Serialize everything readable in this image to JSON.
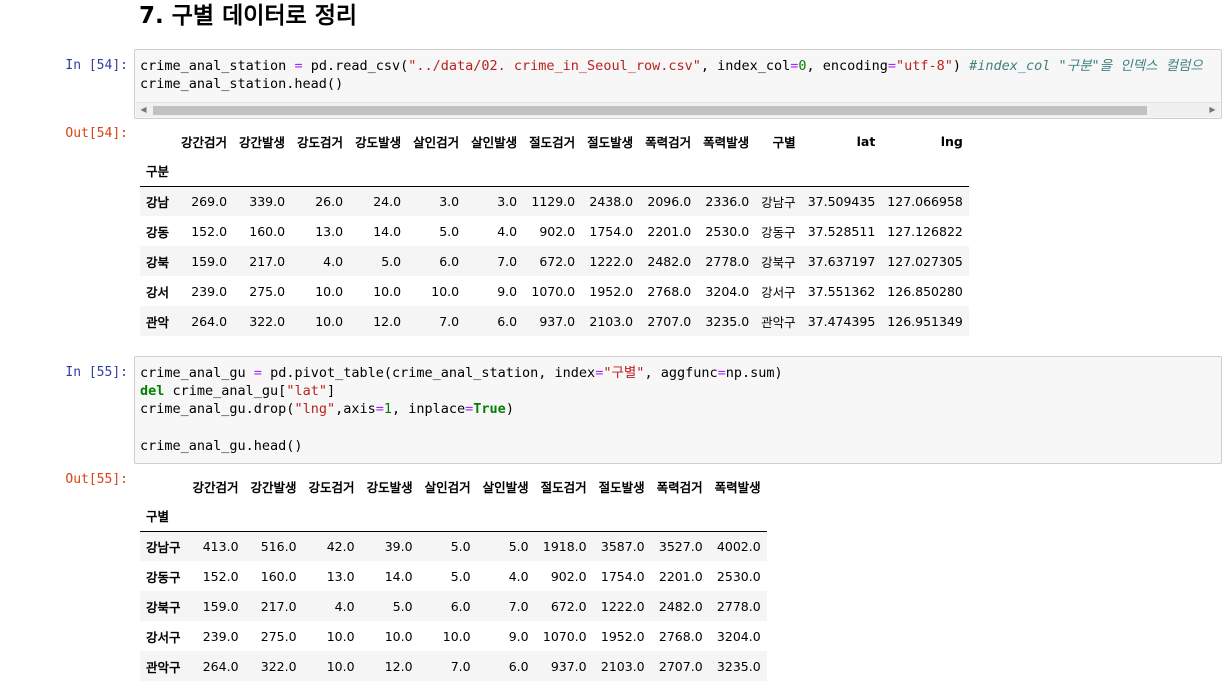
{
  "heading": "7. 구별 데이터로 정리",
  "cell54": {
    "in_prompt": "In [54]:",
    "out_prompt": "Out[54]:",
    "code": [
      [
        [
          "crime_anal_station ",
          ""
        ],
        [
          "=",
          "op"
        ],
        [
          " pd.read_csv(",
          ""
        ],
        [
          "\"../data/02. crime_in_Seoul_row.csv\"",
          "str"
        ],
        [
          ", index_col",
          ""
        ],
        [
          "=",
          "op"
        ],
        [
          "0",
          "num"
        ],
        [
          ", encoding",
          ""
        ],
        [
          "=",
          "op"
        ],
        [
          "\"utf-8\"",
          "str"
        ],
        [
          ") ",
          ""
        ],
        [
          "#index_col \"구분\"을 인덱스 컬럼으",
          "cm"
        ]
      ],
      [
        [
          "crime_anal_station.head()",
          ""
        ]
      ]
    ],
    "table": {
      "columns": [
        "강간검거",
        "강간발생",
        "강도검거",
        "강도발생",
        "살인검거",
        "살인발생",
        "절도검거",
        "절도발생",
        "폭력검거",
        "폭력발생",
        "구별",
        "lat",
        "lng"
      ],
      "index_name": "구분",
      "rows": [
        {
          "index": "강남",
          "values": [
            "269.0",
            "339.0",
            "26.0",
            "24.0",
            "3.0",
            "3.0",
            "1129.0",
            "2438.0",
            "2096.0",
            "2336.0",
            "강남구",
            "37.509435",
            "127.066958"
          ]
        },
        {
          "index": "강동",
          "values": [
            "152.0",
            "160.0",
            "13.0",
            "14.0",
            "5.0",
            "4.0",
            "902.0",
            "1754.0",
            "2201.0",
            "2530.0",
            "강동구",
            "37.528511",
            "127.126822"
          ]
        },
        {
          "index": "강북",
          "values": [
            "159.0",
            "217.0",
            "4.0",
            "5.0",
            "6.0",
            "7.0",
            "672.0",
            "1222.0",
            "2482.0",
            "2778.0",
            "강북구",
            "37.637197",
            "127.027305"
          ]
        },
        {
          "index": "강서",
          "values": [
            "239.0",
            "275.0",
            "10.0",
            "10.0",
            "10.0",
            "9.0",
            "1070.0",
            "1952.0",
            "2768.0",
            "3204.0",
            "강서구",
            "37.551362",
            "126.850280"
          ]
        },
        {
          "index": "관악",
          "values": [
            "264.0",
            "322.0",
            "10.0",
            "12.0",
            "7.0",
            "6.0",
            "937.0",
            "2103.0",
            "2707.0",
            "3235.0",
            "관악구",
            "37.474395",
            "126.951349"
          ]
        }
      ]
    }
  },
  "cell55": {
    "in_prompt": "In [55]:",
    "out_prompt": "Out[55]:",
    "code": [
      [
        [
          "crime_anal_gu ",
          ""
        ],
        [
          "=",
          "op"
        ],
        [
          " pd.pivot_table(crime_anal_station, index",
          ""
        ],
        [
          "=",
          "op"
        ],
        [
          "\"구별\"",
          "str"
        ],
        [
          ", aggfunc",
          ""
        ],
        [
          "=",
          "op"
        ],
        [
          "np.sum)",
          ""
        ]
      ],
      [
        [
          "del",
          "kw"
        ],
        [
          " crime_anal_gu[",
          ""
        ],
        [
          "\"lat\"",
          "str"
        ],
        [
          "]",
          ""
        ]
      ],
      [
        [
          "crime_anal_gu.drop(",
          ""
        ],
        [
          "\"lng\"",
          "str"
        ],
        [
          ",axis",
          ""
        ],
        [
          "=",
          "op"
        ],
        [
          "1",
          "num"
        ],
        [
          ", inplace",
          ""
        ],
        [
          "=",
          "op"
        ],
        [
          "True",
          "kw"
        ],
        [
          ")",
          ""
        ]
      ],
      [],
      [
        [
          "crime_anal_gu.head()",
          ""
        ]
      ]
    ],
    "table": {
      "columns": [
        "강간검거",
        "강간발생",
        "강도검거",
        "강도발생",
        "살인검거",
        "살인발생",
        "절도검거",
        "절도발생",
        "폭력검거",
        "폭력발생"
      ],
      "index_name": "구별",
      "rows": [
        {
          "index": "강남구",
          "values": [
            "413.0",
            "516.0",
            "42.0",
            "39.0",
            "5.0",
            "5.0",
            "1918.0",
            "3587.0",
            "3527.0",
            "4002.0"
          ]
        },
        {
          "index": "강동구",
          "values": [
            "152.0",
            "160.0",
            "13.0",
            "14.0",
            "5.0",
            "4.0",
            "902.0",
            "1754.0",
            "2201.0",
            "2530.0"
          ]
        },
        {
          "index": "강북구",
          "values": [
            "159.0",
            "217.0",
            "4.0",
            "5.0",
            "6.0",
            "7.0",
            "672.0",
            "1222.0",
            "2482.0",
            "2778.0"
          ]
        },
        {
          "index": "강서구",
          "values": [
            "239.0",
            "275.0",
            "10.0",
            "10.0",
            "10.0",
            "9.0",
            "1070.0",
            "1952.0",
            "2768.0",
            "3204.0"
          ]
        },
        {
          "index": "관악구",
          "values": [
            "264.0",
            "322.0",
            "10.0",
            "12.0",
            "7.0",
            "6.0",
            "937.0",
            "2103.0",
            "2707.0",
            "3235.0"
          ]
        }
      ]
    }
  },
  "scrollbar": {
    "left_arrow": "◀",
    "right_arrow": "▶"
  }
}
